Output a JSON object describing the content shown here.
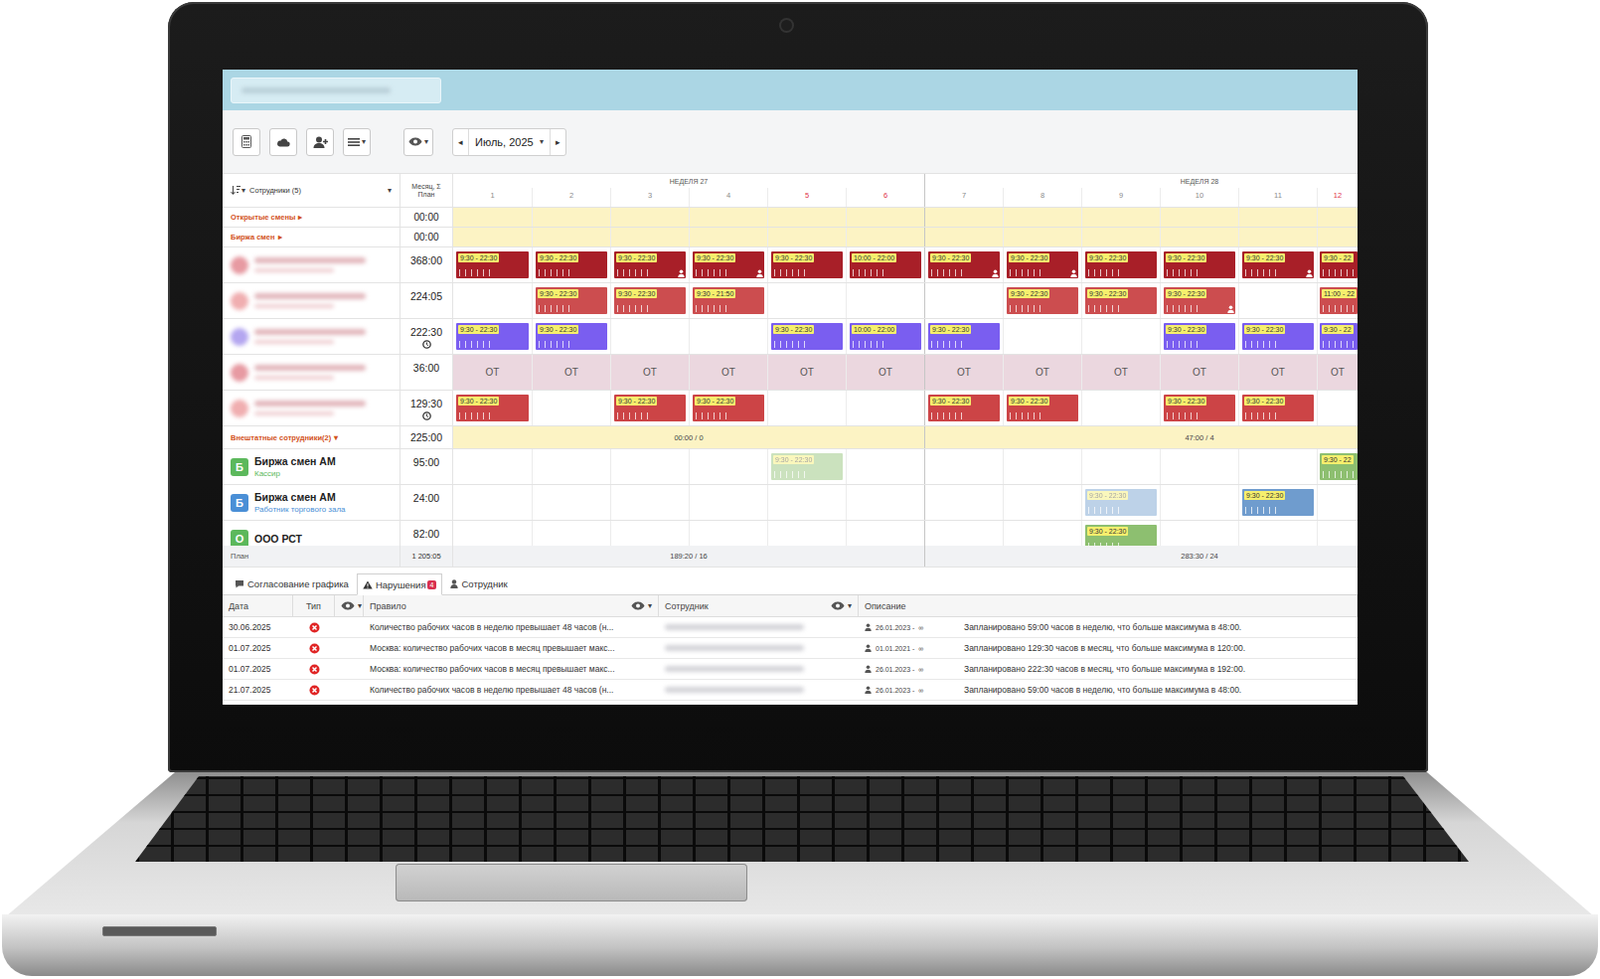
{
  "toolbar": {
    "list_caret": "▾",
    "view_caret": "▾",
    "prev": "◂",
    "month": "Июль, 2025",
    "month_caret": "▾",
    "next": "▸"
  },
  "grid": {
    "sort_caret": "▾",
    "employees_label": "Сотрудники (5)",
    "employees_caret": "▾",
    "total_label": [
      "Месяц, Σ",
      "План"
    ],
    "weeks": [
      {
        "label": "НЕДЕЛЯ 27",
        "span": 6
      },
      {
        "label": "НЕДЕЛЯ 28",
        "span": 7
      }
    ],
    "days": [
      {
        "label": "1",
        "weekend": false
      },
      {
        "label": "2",
        "weekend": false
      },
      {
        "label": "3",
        "weekend": false
      },
      {
        "label": "4",
        "weekend": false
      },
      {
        "label": "5",
        "weekend": true
      },
      {
        "label": "6",
        "weekend": true
      },
      {
        "label": "7",
        "weekend": false
      },
      {
        "label": "8",
        "weekend": false
      },
      {
        "label": "9",
        "weekend": false
      },
      {
        "label": "10",
        "weekend": false
      },
      {
        "label": "11",
        "weekend": false
      },
      {
        "label": "12",
        "weekend": true
      }
    ],
    "summary_rows": [
      {
        "label": "Открытые смены",
        "arrow": "▸",
        "total": "00:00"
      },
      {
        "label": "Биржа смен",
        "arrow": "▸",
        "total": "00:00"
      }
    ],
    "employees": [
      {
        "kind": "shifts",
        "total": "368:00",
        "clock": false,
        "avatar_color": "#e79aa2",
        "shift_color": "#a81f28",
        "shifts": [
          {
            "day": 1,
            "time": "9:30 - 22:30",
            "flag": false
          },
          {
            "day": 2,
            "time": "9:30 - 22:30",
            "flag": false
          },
          {
            "day": 3,
            "time": "9:30 - 22:30",
            "flag": true
          },
          {
            "day": 4,
            "time": "9:30 - 22:30",
            "flag": true
          },
          {
            "day": 5,
            "time": "9:30 - 22:30",
            "flag": false
          },
          {
            "day": 6,
            "time": "10:00 - 22:00",
            "flag": false
          },
          {
            "day": 7,
            "time": "9:30 - 22:30",
            "flag": true
          },
          {
            "day": 8,
            "time": "9:30 - 22:30",
            "flag": true
          },
          {
            "day": 9,
            "time": "9:30 - 22:30",
            "flag": false
          },
          {
            "day": 10,
            "time": "9:30 - 22:30",
            "flag": false
          },
          {
            "day": 11,
            "time": "9:30 - 22:30",
            "flag": true
          },
          {
            "day": 12,
            "time": "9:30 - 22",
            "flag": false
          }
        ]
      },
      {
        "kind": "shifts",
        "total": "224:05",
        "clock": false,
        "avatar_color": "#f0aeb0",
        "shift_color": "#cc4d4f",
        "shifts": [
          {
            "day": 2,
            "time": "9:30 - 22:30",
            "flag": false
          },
          {
            "day": 3,
            "time": "9:30 - 22:30",
            "flag": false
          },
          {
            "day": 4,
            "time": "9:30 - 21:50",
            "flag": false
          },
          {
            "day": 8,
            "time": "9:30 - 22:30",
            "flag": false
          },
          {
            "day": 9,
            "time": "9:30 - 22:30",
            "flag": false
          },
          {
            "day": 10,
            "time": "9:30 - 22:30",
            "flag": true
          },
          {
            "day": 12,
            "time": "11:00 - 22",
            "flag": false
          }
        ]
      },
      {
        "kind": "shifts",
        "total": "222:30",
        "clock": true,
        "avatar_color": "#b4a6f0",
        "shift_color": "#7a5ef0",
        "shifts": [
          {
            "day": 1,
            "time": "9:30 - 22:30",
            "flag": false
          },
          {
            "day": 2,
            "time": "9:30 - 22:30",
            "flag": false
          },
          {
            "day": 5,
            "time": "9:30 - 22:30",
            "flag": false
          },
          {
            "day": 6,
            "time": "10:00 - 22:00",
            "flag": false
          },
          {
            "day": 7,
            "time": "9:30 - 22:30",
            "flag": false
          },
          {
            "day": 10,
            "time": "9:30 - 22:30",
            "flag": false
          },
          {
            "day": 11,
            "time": "9:30 - 22:30",
            "flag": false
          },
          {
            "day": 12,
            "time": "9:30 - 22",
            "flag": false
          }
        ]
      },
      {
        "kind": "absence",
        "total": "36:00",
        "clock": false,
        "avatar_color": "#e79aa2",
        "cells": [
          {
            "day": 1,
            "label": "ОТ"
          },
          {
            "day": 2,
            "label": "ОТ"
          },
          {
            "day": 3,
            "label": "ОТ"
          },
          {
            "day": 4,
            "label": "ОТ"
          },
          {
            "day": 5,
            "label": "ОТ"
          },
          {
            "day": 6,
            "label": "ОТ"
          },
          {
            "day": 7,
            "label": "ОТ"
          },
          {
            "day": 8,
            "label": "ОТ"
          },
          {
            "day": 9,
            "label": "ОТ"
          },
          {
            "day": 10,
            "label": "ОТ"
          },
          {
            "day": 11,
            "label": "ОТ"
          },
          {
            "day": 12,
            "label": "ОТ"
          }
        ]
      },
      {
        "kind": "shifts",
        "total": "129:30",
        "clock": true,
        "avatar_color": "#f0aeb0",
        "shift_color": "#cc4446",
        "shifts": [
          {
            "day": 1,
            "time": "9:30 - 22:30",
            "flag": false
          },
          {
            "day": 3,
            "time": "9:30 - 22:30",
            "flag": false
          },
          {
            "day": 4,
            "time": "9:30 - 22:30",
            "flag": false
          },
          {
            "day": 7,
            "time": "9:30 - 22:30",
            "flag": false
          },
          {
            "day": 8,
            "time": "9:30 - 22:30",
            "flag": false
          },
          {
            "day": 10,
            "time": "9:30 - 22:30",
            "flag": false
          },
          {
            "day": 11,
            "time": "9:30 - 22:30",
            "flag": false
          }
        ]
      }
    ],
    "external_group": {
      "label": "Внештатные сотрудники(2)",
      "caret": "▾",
      "total": "225:00",
      "weeks": [
        "00:00 / 0",
        "47:00 / 4"
      ]
    },
    "external": [
      {
        "badge": "Б",
        "color": "#5cb85c",
        "name": "Биржа смен АМ",
        "role": "Кассир",
        "total": "95:00",
        "shift_color": "#8dbf70",
        "shifts": [
          {
            "day": 5,
            "time": "9:30 - 22:30",
            "faded": true
          },
          {
            "day": 12,
            "time": "9:30 - 22",
            "faded": false
          }
        ]
      },
      {
        "badge": "Б",
        "color": "#4a8fd6",
        "name": "Биржа смен АМ",
        "role": "Работник торгового зала",
        "total": "24:00",
        "shift_color": "#6f9cce",
        "shifts": [
          {
            "day": 9,
            "time": "9:30 - 22:30",
            "faded": true
          },
          {
            "day": 11,
            "time": "9:30 - 22:30",
            "faded": false
          }
        ]
      },
      {
        "badge": "О",
        "color": "#5cb85c",
        "name": "ООО РСТ",
        "total": "82:00",
        "shift_color": "#8dbf70",
        "shifts": [
          {
            "day": 9,
            "time": "9:30 - 22:30",
            "faded": false
          }
        ]
      }
    ],
    "footer": {
      "label": "План",
      "total": "1 205:05",
      "weeks": [
        "189:20 / 16",
        "283:30 / 24"
      ]
    }
  },
  "tabs": [
    {
      "label": "Согласование графика",
      "selected": false
    },
    {
      "label": "Нарушения",
      "badge": "4",
      "selected": true
    },
    {
      "label": "Сотрудник",
      "selected": false
    }
  ],
  "violations": {
    "columns": {
      "date": "Дата",
      "type": "Тип",
      "rule": "Правило",
      "employee": "Сотрудник",
      "description": "Описание"
    },
    "caret": "▾",
    "rows": [
      {
        "date": "30.06.2025",
        "kind": "error",
        "rule": "Количество рабочих часов в неделю превышает 48 часов (н...",
        "period": "26.01.2023 -",
        "period_end": "∞",
        "description": "Запланировано 59:00 часов в неделю, что больше максимума в 48:00."
      },
      {
        "date": "01.07.2025",
        "kind": "error",
        "rule": "Москва: количество рабочих часов в месяц превышает макс...",
        "period": "01.01.2021 -",
        "period_end": "∞",
        "description": "Запланировано 129:30 часов в месяц, что больше максимума в 120:00."
      },
      {
        "date": "01.07.2025",
        "kind": "error",
        "rule": "Москва: количество рабочих часов в месяц превышает макс...",
        "period": "26.01.2023 -",
        "period_end": "∞",
        "description": "Запланировано 222:30 часов в месяц, что больше максимума в 192:00."
      },
      {
        "date": "21.07.2025",
        "kind": "error",
        "rule": "Количество рабочих часов в неделю превышает 48 часов (н...",
        "period": "26.01.2023 -",
        "period_end": "∞",
        "description": "Запланировано 59:00 часов в неделю, что больше максимума в 48:00."
      }
    ]
  }
}
